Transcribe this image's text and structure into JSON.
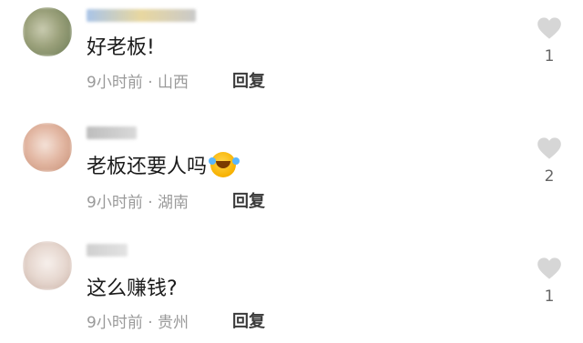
{
  "comments": [
    {
      "text": "好老板!",
      "time": "9小时前",
      "separator": "·",
      "location": "山西",
      "reply_label": "回复",
      "likes": "1",
      "avatar_colors": [
        "#9aa07a",
        "#6a7a55",
        "#c9cbb0"
      ]
    },
    {
      "text": "老板还要人吗",
      "emoji": "rofl-emoji",
      "time": "9小时前",
      "separator": "·",
      "location": "湖南",
      "reply_label": "回复",
      "likes": "2",
      "avatar_colors": [
        "#e3b8a4",
        "#c58d73",
        "#f4e2d8"
      ]
    },
    {
      "text": "这么赚钱?",
      "time": "9小时前",
      "separator": "·",
      "location": "贵州",
      "reply_label": "回复",
      "likes": "1",
      "avatar_colors": [
        "#e6d7cf",
        "#c9b1a6",
        "#f7f0ec"
      ]
    }
  ],
  "icons": {
    "like": "heart-icon"
  },
  "colors": {
    "heart": "#d6d6d6",
    "meta_text": "#9a9a9a",
    "comment_text": "#1b1b1b"
  }
}
